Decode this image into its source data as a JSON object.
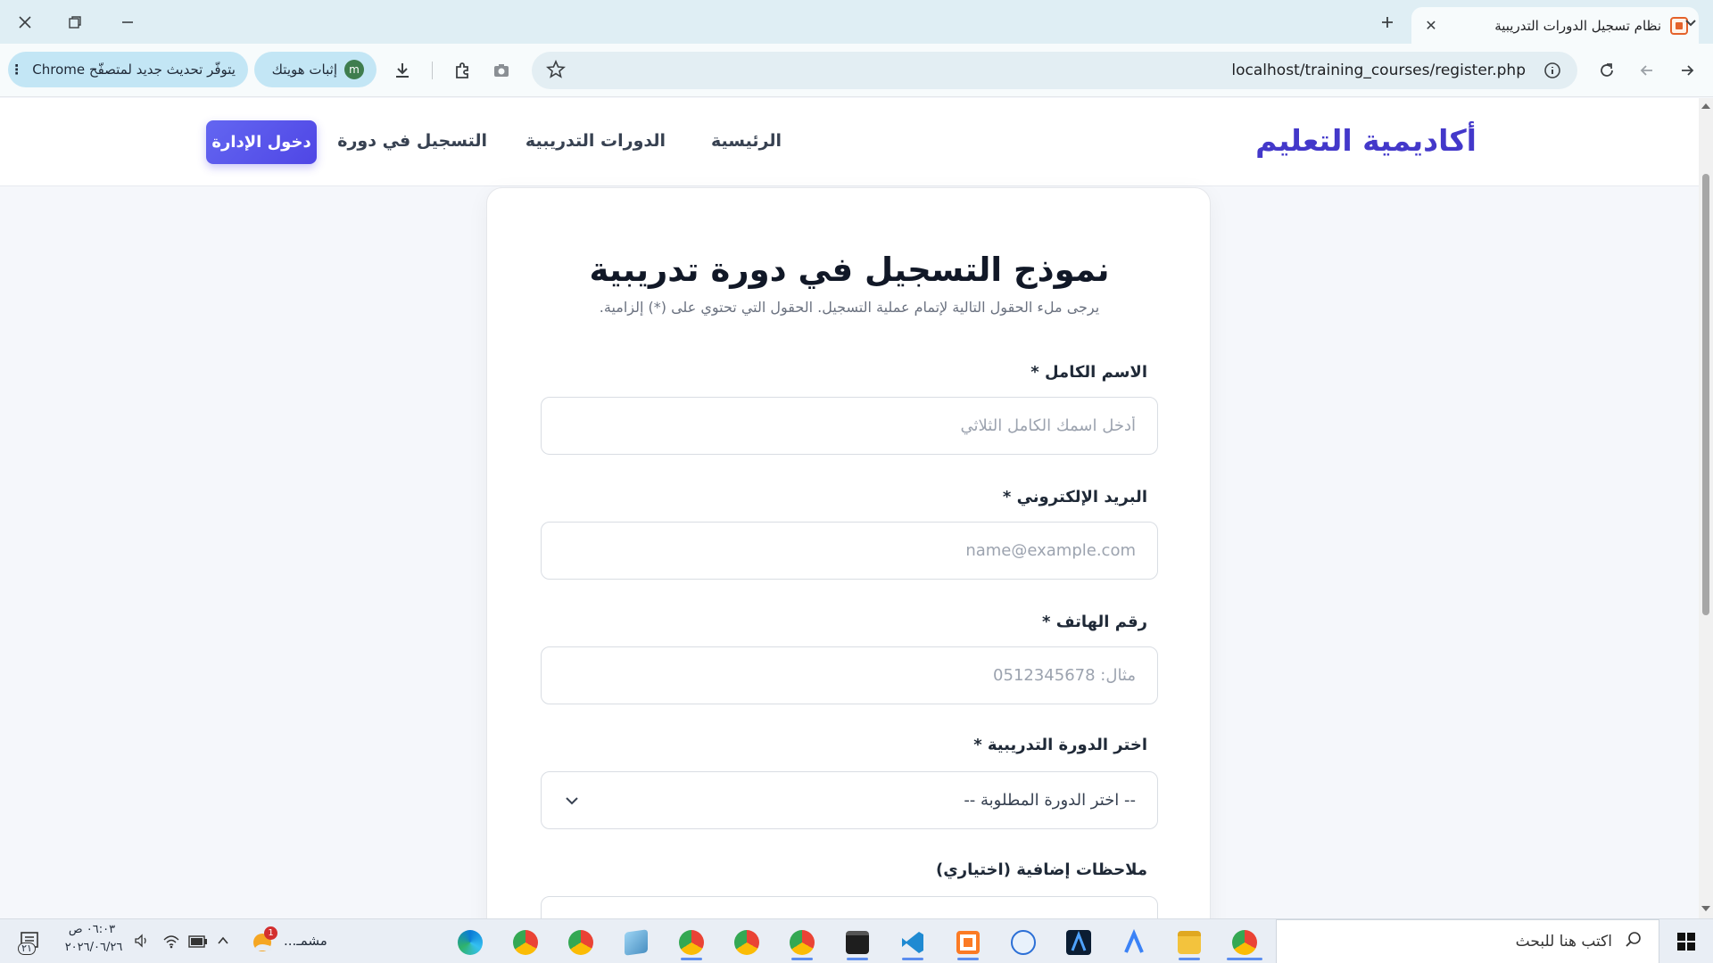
{
  "browser": {
    "tab_title": "نظام تسجيل الدورات التدريبية",
    "url": "localhost/training_courses/register.php",
    "profile_label": "إثبات هويتك",
    "update_label": "يتوفّر تحديث جديد لمتصفّح Chrome"
  },
  "nav": {
    "brand": "أكاديمية التعليم",
    "links": [
      "الرئيسية",
      "الدورات التدريبية",
      "التسجيل في دورة"
    ],
    "admin_button": "دخول الإدارة"
  },
  "form": {
    "title": "نموذج التسجيل في دورة تدريبية",
    "subtitle": "يرجى ملء الحقول التالية لإتمام عملية التسجيل. الحقول التي تحتوي على (*) إلزامية.",
    "fields": [
      {
        "label": "الاسم الكامل *",
        "placeholder": "أدخل اسمك الكامل الثلاثي"
      },
      {
        "label": "البريد الإلكتروني *",
        "placeholder": "name@example.com"
      },
      {
        "label": "رقم الهاتف *",
        "placeholder": "مثال: 0512345678"
      }
    ],
    "course_label": "اختر الدورة التدريبية *",
    "course_selected": "-- اختر الدورة المطلوبة --",
    "notes_label": "ملاحظات إضافية (اختياري)"
  },
  "taskbar": {
    "search_placeholder": "اكتب هنا للبحث",
    "weather_label": "مشمـ...",
    "notification_count": "1",
    "time": "٠٦:٠٣ ص",
    "date": "٢٠٢٦/٠٦/٢٦",
    "action_center_count": "٢١"
  }
}
